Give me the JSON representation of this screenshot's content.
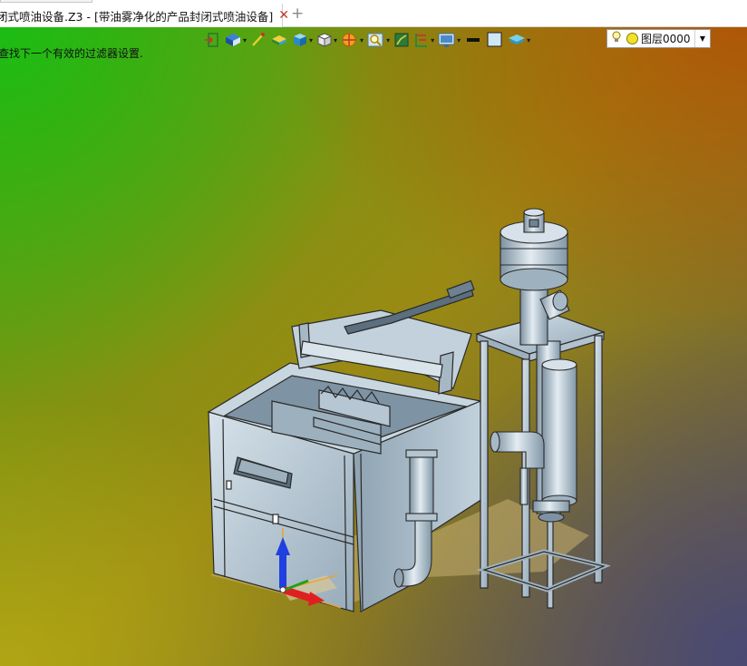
{
  "tab": {
    "title": "闭式喷油设备.Z3 - [带油雾净化的产品封闭式喷油设备]",
    "close_glyph": "✕",
    "add_glyph": "+"
  },
  "status": {
    "hint": "查找下一个有效的过滤器设置."
  },
  "toolbar": {
    "buttons": [
      {
        "name": "exit-icon",
        "has_dropdown": false
      },
      {
        "name": "view-orientation-icon",
        "has_dropdown": true
      },
      {
        "name": "pick-filter-icon",
        "has_dropdown": false
      },
      {
        "name": "shaded-display-icon",
        "has_dropdown": false
      },
      {
        "name": "solid-cube-icon",
        "has_dropdown": true
      },
      {
        "name": "wire-cube-icon",
        "has_dropdown": true
      },
      {
        "name": "section-view-icon",
        "has_dropdown": true
      },
      {
        "name": "zoom-icon",
        "has_dropdown": true
      },
      {
        "name": "fit-view-icon",
        "has_dropdown": false
      },
      {
        "name": "measure-icon",
        "has_dropdown": true
      },
      {
        "name": "display-settings-icon",
        "has_dropdown": true
      },
      {
        "name": "line-style-icon",
        "has_dropdown": false
      },
      {
        "name": "color-swatch-icon",
        "has_dropdown": false
      },
      {
        "name": "layer-manager-icon",
        "has_dropdown": true
      }
    ],
    "layer": {
      "value": "图层0000",
      "color": "#f2e12b"
    }
  },
  "colors": {
    "viewport_green": "#18be14",
    "viewport_orange": "#b05406",
    "viewport_purple": "#484876",
    "model_steel": "#b9cad6",
    "model_edge": "#2a2a2a",
    "axis_x": "#e02020",
    "axis_y": "#20a020",
    "axis_z": "#2040e0",
    "triad_yellow": "#f0a020"
  }
}
